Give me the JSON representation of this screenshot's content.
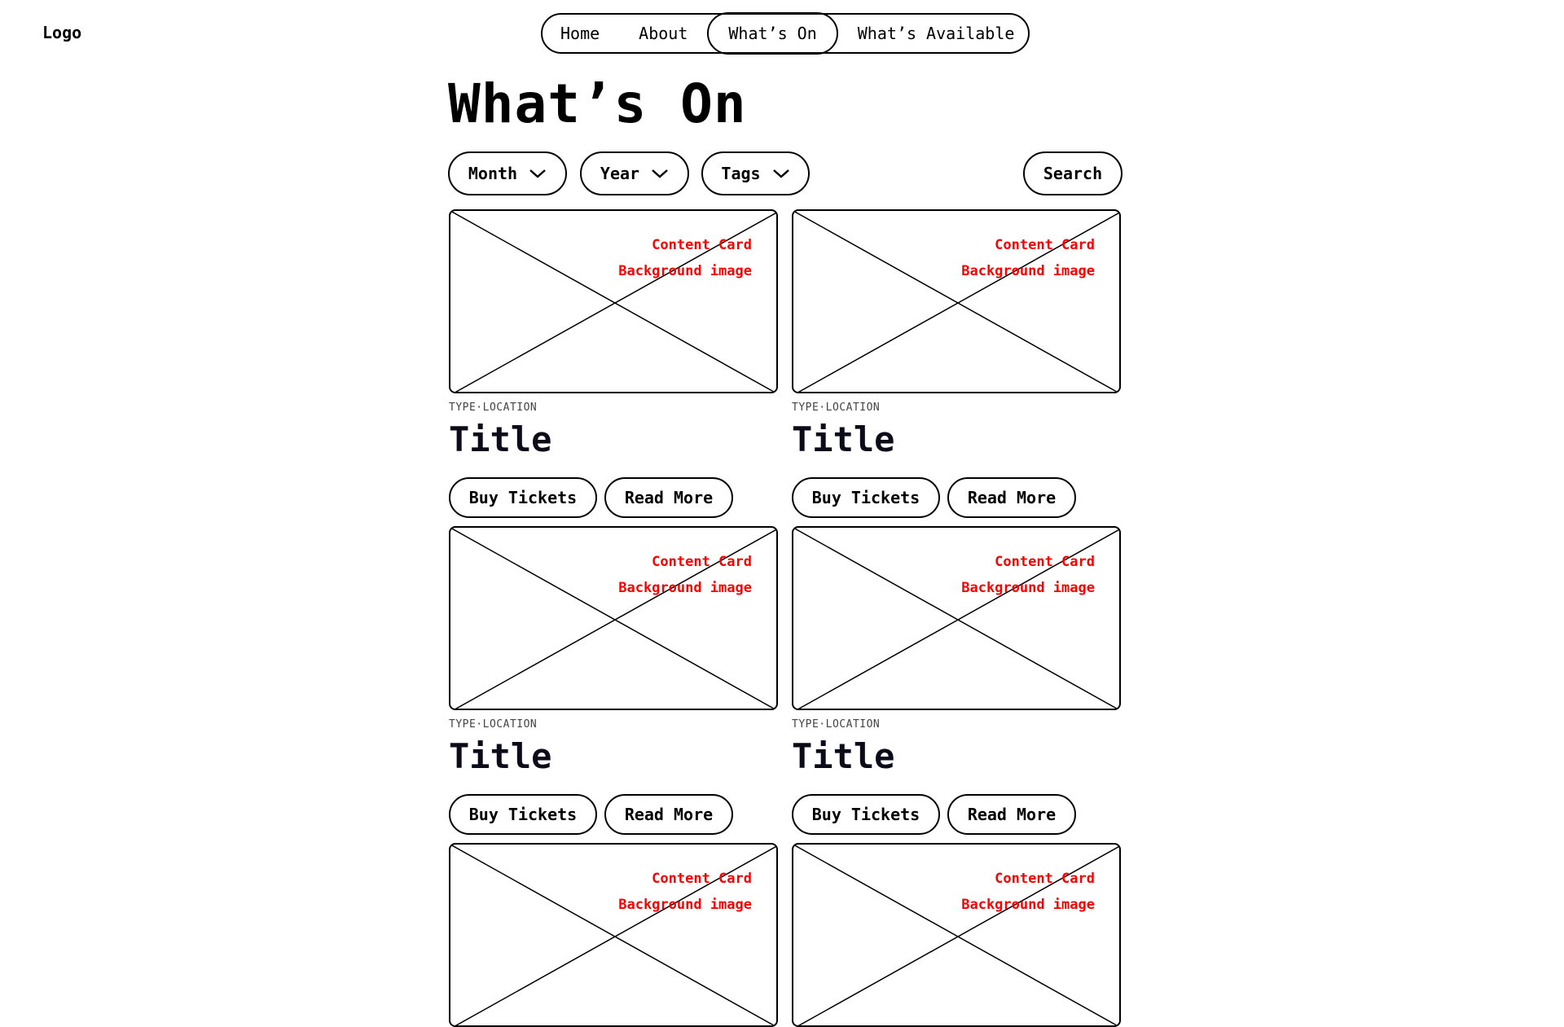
{
  "header": {
    "logo": "Logo"
  },
  "nav": {
    "items": [
      {
        "label": "Home"
      },
      {
        "label": "About"
      },
      {
        "label": "What’s On",
        "active": true
      },
      {
        "label": "What’s Available"
      }
    ]
  },
  "page": {
    "title": "What’s On"
  },
  "filters": {
    "month": "Month",
    "year": "Year",
    "tags": "Tags",
    "search": "Search"
  },
  "cards": [
    {
      "note_line1": "Content Card",
      "note_line2": "Background image",
      "meta": "TYPE·LOCATION",
      "title": "Title",
      "buy": "Buy Tickets",
      "read": "Read More"
    },
    {
      "note_line1": "Content Card",
      "note_line2": "Background image",
      "meta": "TYPE·LOCATION",
      "title": "Title",
      "buy": "Buy Tickets",
      "read": "Read More"
    },
    {
      "note_line1": "Content Card",
      "note_line2": "Background image",
      "meta": "TYPE·LOCATION",
      "title": "Title",
      "buy": "Buy Tickets",
      "read": "Read More"
    },
    {
      "note_line1": "Content Card",
      "note_line2": "Background image",
      "meta": "TYPE·LOCATION",
      "title": "Title",
      "buy": "Buy Tickets",
      "read": "Read More"
    },
    {
      "note_line1": "Content Card",
      "note_line2": "Background image"
    },
    {
      "note_line1": "Content Card",
      "note_line2": "Background image"
    }
  ],
  "colors": {
    "annotation": "#ff0000",
    "stroke": "#000000",
    "title": "#0b0b1a"
  },
  "icons": {
    "dropdown": "chevron-down-icon",
    "placeholder": "image-placeholder-icon"
  }
}
